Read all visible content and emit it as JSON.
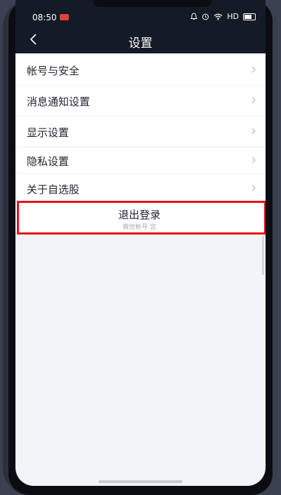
{
  "status_bar": {
    "time": "08:50",
    "icons": [
      "notification-icon",
      "alarm-icon",
      "wifi-icon",
      "hd-icon",
      "battery-icon"
    ],
    "network": "HD"
  },
  "nav": {
    "back_icon": "chevron-left-icon",
    "title": "设置"
  },
  "groups": [
    {
      "items": [
        {
          "label": "帐号与安全"
        }
      ]
    },
    {
      "items": [
        {
          "label": "消息通知设置"
        }
      ]
    },
    {
      "items": [
        {
          "label": "显示设置"
        },
        {
          "label": "隐私设置"
        }
      ]
    },
    {
      "items": [
        {
          "label": "关于自选股"
        }
      ]
    }
  ],
  "logout": {
    "label": "退出登录",
    "subtitle": "微信帐号:宫"
  },
  "colors": {
    "nav_background": "#141a26",
    "page_background": "#f3f4f7",
    "highlight": "#e8101b"
  }
}
